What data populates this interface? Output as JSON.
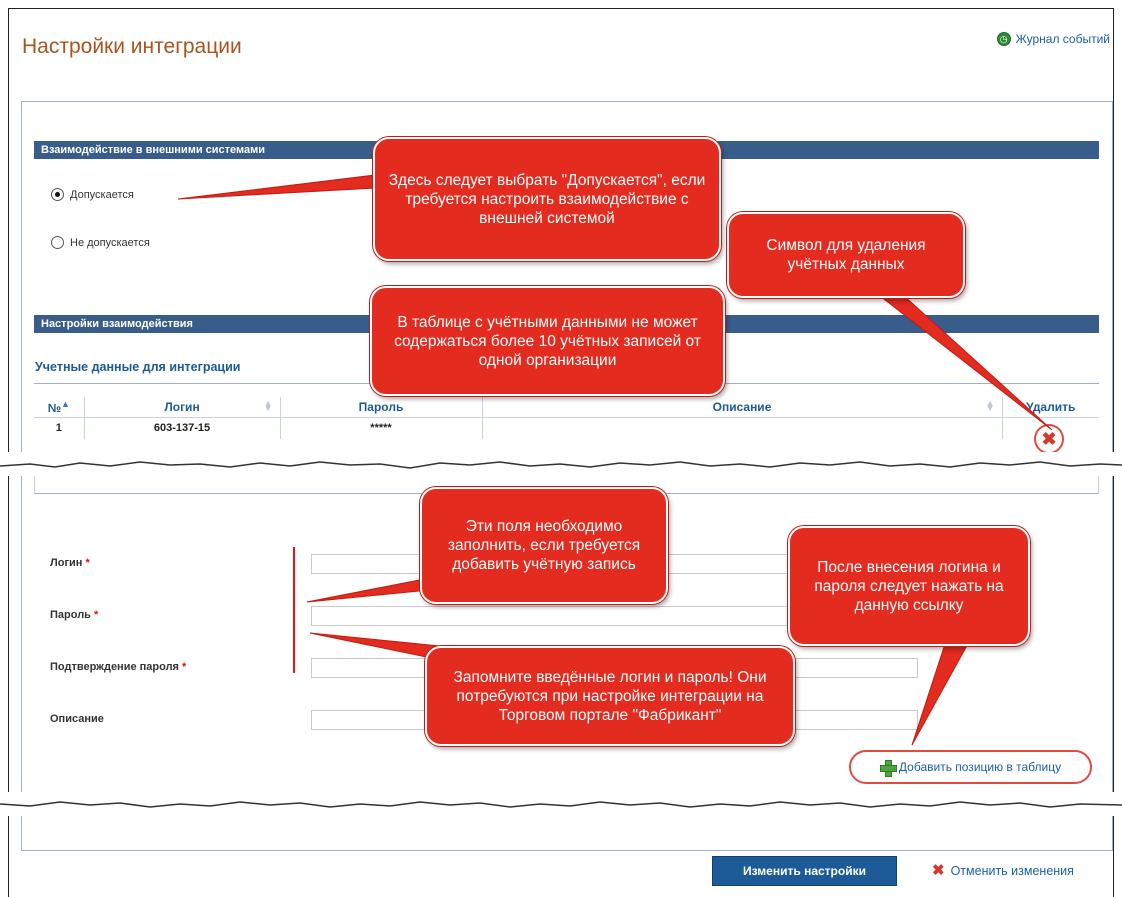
{
  "page": {
    "title": "Настройки интеграции",
    "journal_link": "Журнал событий"
  },
  "interaction": {
    "header": "Взаимодействие в внешними системами",
    "options": [
      "Допускается",
      "Не допускается"
    ],
    "selected": "Допускается"
  },
  "settings": {
    "header": "Настройки взаимодействия",
    "subtitle": "Учетные данные для интеграции",
    "table": {
      "columns": [
        "№",
        "Логин",
        "Пароль",
        "Описание",
        "Удалить"
      ],
      "rows": [
        {
          "num": "1",
          "login": "603-137-15",
          "password": "*****",
          "description": ""
        }
      ]
    }
  },
  "form": {
    "login_label": "Логин",
    "password_label": "Пароль",
    "confirm_label": "Подтверждение пароля",
    "description_label": "Описание",
    "required_mark": "*",
    "add_link": "Добавить позицию в таблицу"
  },
  "actions": {
    "apply": "Изменить настройки",
    "cancel": "Отменить изменения"
  },
  "callouts": {
    "select_allowed": "Здесь следует выбрать \"Допускается\", если требуется настроить взаимодействие с внешней системой",
    "delete_symbol": "Символ для удаления учётных данных",
    "max_records": "В таблице с учётными данными не может содержаться более 10 учётных записей от одной организации",
    "fill_fields": "Эти поля необходимо заполнить, если требуется добавить учётную запись",
    "after_entry": "После внесения логина и пароля следует нажать на данную ссылку",
    "remember": "Запомните введённые логин и пароль! Они потребуются при настройке интеграции на Торговом портале \"Фабрикант\""
  },
  "colors": {
    "header_bar": "#385d8a",
    "accent_blue": "#1c5b98",
    "callout_red": "#e32b1f",
    "title_brown": "#a8541e"
  }
}
